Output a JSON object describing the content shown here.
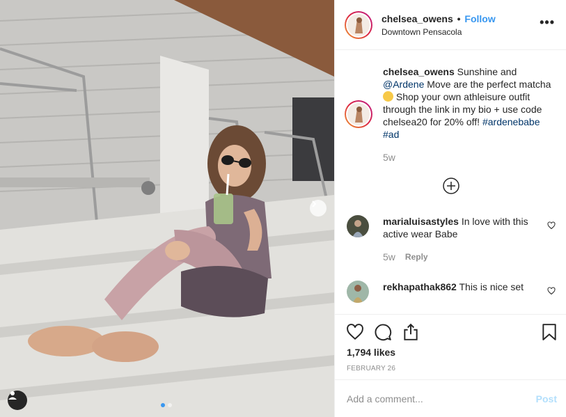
{
  "header": {
    "username": "chelsea_owens",
    "separator": "•",
    "follow_label": "Follow",
    "location": "Downtown Pensacola",
    "more_label": "•••"
  },
  "caption": {
    "username": "chelsea_owens",
    "text_1": " Sunshine and ",
    "mention": "@Ardene",
    "text_2": " Move are the perfect matcha ",
    "text_3": " Shop your own athleisure outfit through the link in my bio + use code chelsea20 for 20% off! ",
    "hashtag_1": "#ardenebabe",
    "hashtag_2": "#ad",
    "time": "5w"
  },
  "comments": [
    {
      "username": "marialuisastyles",
      "text": " In love with this active wear Babe",
      "time": "5w",
      "reply_label": "Reply"
    },
    {
      "username": "rekhapathak862",
      "text": " This is nice set"
    }
  ],
  "actions": {
    "likes": "1,794 likes",
    "date": "FEBRUARY 26"
  },
  "add_comment": {
    "placeholder": "Add a comment...",
    "post_label": "Post"
  },
  "icons": [
    "next-arrow-icon",
    "user-tag-icon",
    "more-options-icon",
    "load-more-icon",
    "heart-icon",
    "comment-icon",
    "share-icon",
    "bookmark-icon"
  ],
  "colors": {
    "link": "#3897f0",
    "hashtag": "#003569",
    "muted": "#8e8e8e",
    "post_disabled": "#b2dffc"
  },
  "carousel": {
    "current": 1,
    "total": 2
  }
}
